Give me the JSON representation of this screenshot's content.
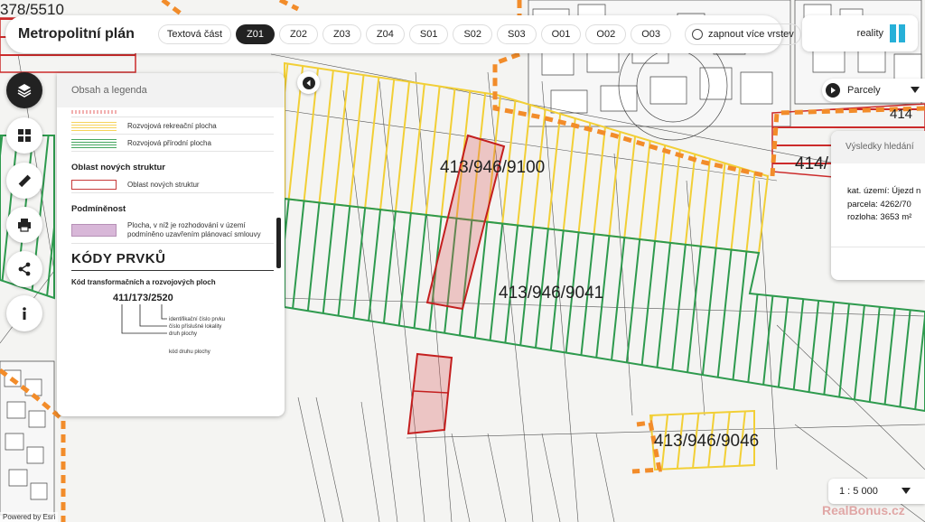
{
  "header": {
    "title": "Metropolitní plán",
    "text_part_label": "Textová část",
    "tabs": [
      "Z01",
      "Z02",
      "Z03",
      "Z04",
      "S01",
      "S02",
      "S03",
      "O01",
      "O02",
      "O03"
    ],
    "active_tab": "Z01",
    "multi_layer_label": "zapnout více vrstev"
  },
  "brand": {
    "name": "reality",
    "accent": "#27b0d8"
  },
  "sidebar_icons": [
    "layers-icon",
    "grid-icon",
    "ruler-icon",
    "print-icon",
    "share-icon",
    "info-icon"
  ],
  "legend": {
    "title": "Obsah a legenda",
    "rows_top": [
      {
        "label": "Rozvojová rekreační plocha",
        "color": "#f6d35b"
      },
      {
        "label": "Rozvojová přírodní plocha",
        "color": "#45a760"
      }
    ],
    "section_new": {
      "title": "Oblast nových struktur",
      "label": "Oblast nových struktur",
      "color": "#c83a3a"
    },
    "section_cond": {
      "title": "Podmíněnost",
      "label_line1": "Plocha, v níž je rozhodování v území",
      "label_line2": "podmíněno uzavřením plánovací smlouvy",
      "color": "#d8b7d8"
    },
    "codes_title": "KÓDY PRVKŮ",
    "codes_subtitle": "Kód transformačních a rozvojových ploch",
    "code_example": "411/173/2520",
    "code_parts": [
      "identifikační číslo prvku",
      "číslo příslušné lokality",
      "druh plochy"
    ],
    "code_note": "kód druhu plochy"
  },
  "map": {
    "labels": [
      {
        "text": "413/946/9100",
        "name": "parcel-label-9100"
      },
      {
        "text": "413/946/9041",
        "name": "parcel-label-9041"
      },
      {
        "text": "413/946/9046",
        "name": "parcel-label-9046"
      },
      {
        "text": "378/5510",
        "name": "parcel-label-378"
      },
      {
        "text": "414/",
        "name": "parcel-label-414"
      },
      {
        "text": "414",
        "name": "parcel-label-414b"
      }
    ],
    "colors": {
      "yellow": "#f2cf36",
      "green": "#2e9a4e",
      "red": "#cc2b2b",
      "orange": "#f28c2a"
    }
  },
  "parcel_select": {
    "value": "Parcely"
  },
  "results": {
    "title": "Výsledky hledání",
    "kat_uzemi": "kat. území: Újezd n",
    "parcela": "parcela: 4262/70",
    "rozloha": "rozloha: 3653 m²"
  },
  "scale": {
    "value": "1 : 5 000"
  },
  "attribution": "Powered by Esri",
  "watermark": "RealBonus.cz"
}
